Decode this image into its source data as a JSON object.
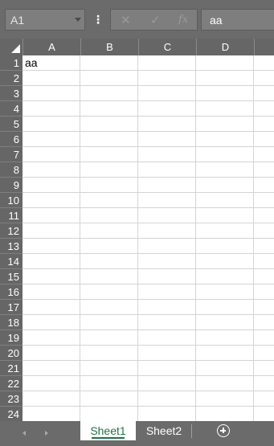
{
  "formula_bar": {
    "name_box": "A1",
    "options_glyph": "⋮",
    "cancel_glyph": "✕",
    "enter_glyph": "✓",
    "fx_label": "fx",
    "formula_value": "aa"
  },
  "grid": {
    "select_all_icon": "select-all-triangle",
    "columns": [
      "A",
      "B",
      "C",
      "D"
    ],
    "rows": [
      "1",
      "2",
      "3",
      "4",
      "5",
      "6",
      "7",
      "8",
      "9",
      "10",
      "11",
      "12",
      "13",
      "14",
      "15",
      "16",
      "17",
      "18",
      "19",
      "20",
      "21",
      "22",
      "23",
      "24"
    ],
    "cells": {
      "A1": "aa"
    }
  },
  "tabs": {
    "scroll_left_icon": "triangle-left-icon",
    "scroll_right_icon": "triangle-right-icon",
    "sheets": [
      "Sheet1",
      "Sheet2"
    ],
    "active": "Sheet1",
    "add_sheet_icon": "plus-circle-icon"
  },
  "colors": {
    "chrome": "#6b6b6b",
    "accent": "#217346"
  }
}
